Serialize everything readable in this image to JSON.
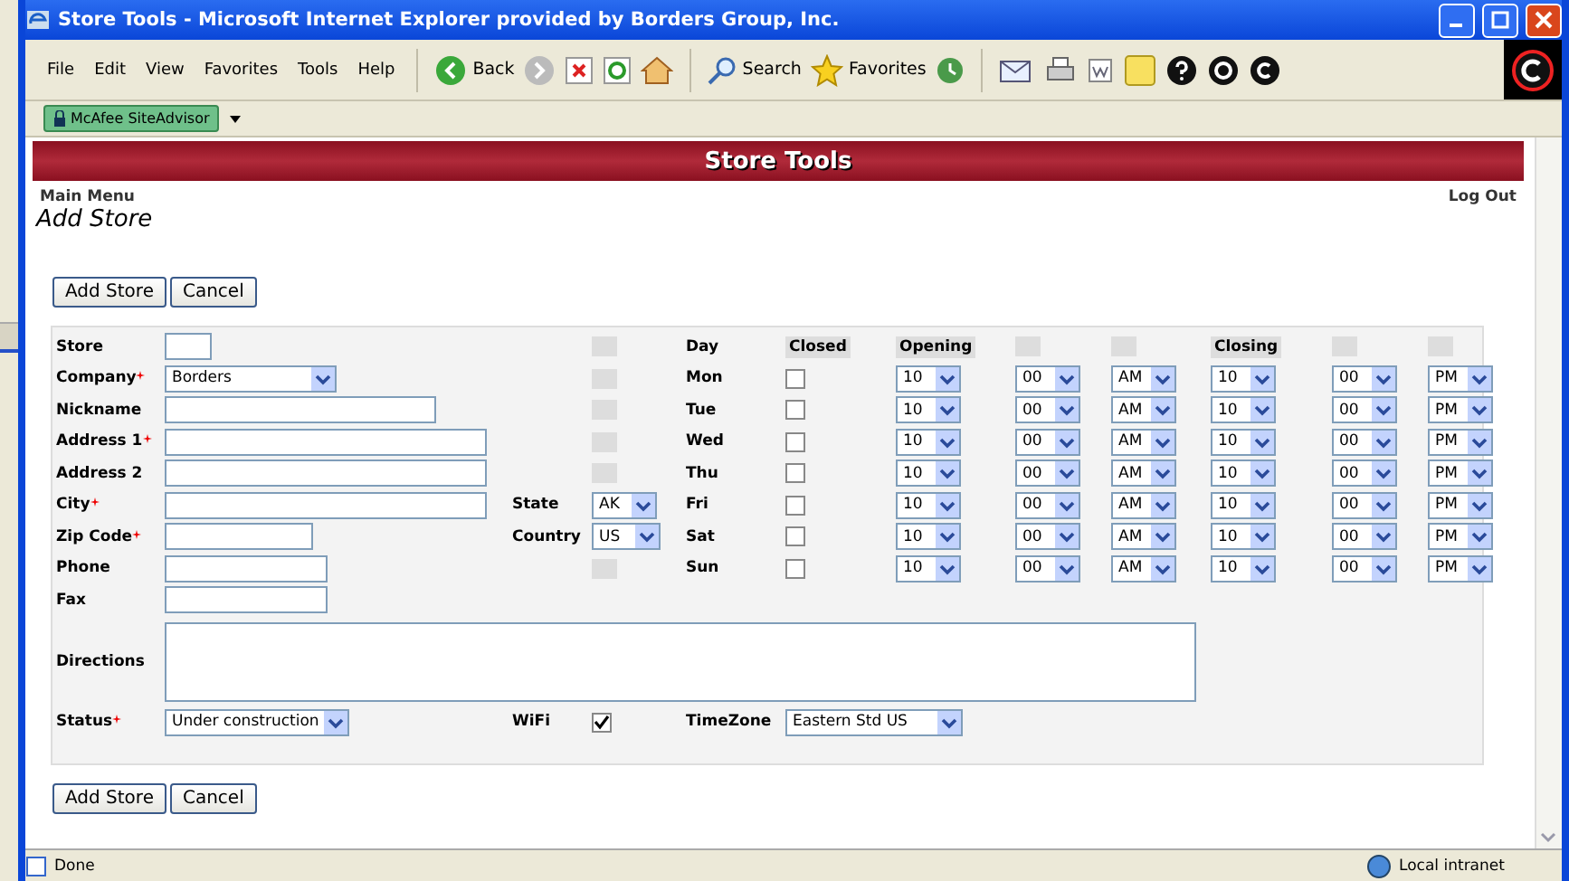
{
  "window": {
    "title": "Store Tools - Microsoft Internet Explorer provided by Borders Group, Inc."
  },
  "menu": [
    "File",
    "Edit",
    "View",
    "Favorites",
    "Tools",
    "Help"
  ],
  "toolbar": {
    "back": "Back",
    "search": "Search",
    "favorites": "Favorites"
  },
  "addon_bar": {
    "button": "McAfee SiteAdvisor"
  },
  "banner": {
    "title": "Store Tools"
  },
  "nav": {
    "main_menu": "Main Menu",
    "log_out": "Log Out"
  },
  "heading": "Add Store",
  "buttons": [
    "Add Store",
    "Cancel"
  ],
  "bottom_buttons": [
    "Add Store",
    "Cancel"
  ],
  "fields": [
    {
      "label": "Store",
      "kind": "text",
      "required": false
    },
    {
      "label": "Company",
      "kind": "select",
      "required": true,
      "value": "Borders"
    },
    {
      "label": "Nickname",
      "kind": "text",
      "required": false
    },
    {
      "label": "Address 1",
      "kind": "text",
      "required": true
    },
    {
      "label": "Address 2",
      "kind": "text",
      "required": false
    },
    {
      "label": "City",
      "kind": "text",
      "required": true
    },
    {
      "label": "Zip Code",
      "kind": "text",
      "required": true
    },
    {
      "label": "Phone",
      "kind": "text",
      "required": false
    },
    {
      "label": "Fax",
      "kind": "text",
      "required": false
    }
  ],
  "location": [
    {
      "label": "State",
      "value": "AK"
    },
    {
      "label": "Country",
      "value": "US"
    }
  ],
  "schedule_headers": {
    "day": "Day",
    "closed": "Closed",
    "opening": "Opening",
    "closing": "Closing"
  },
  "days": [
    {
      "day": "Mon",
      "closed": false,
      "open_hour": "10",
      "open_minute": "00",
      "open_ampm": "AM",
      "close_hour": "10",
      "close_minute": "00",
      "close_ampm": "PM"
    },
    {
      "day": "Tue",
      "closed": false,
      "open_hour": "10",
      "open_minute": "00",
      "open_ampm": "AM",
      "close_hour": "10",
      "close_minute": "00",
      "close_ampm": "PM"
    },
    {
      "day": "Wed",
      "closed": false,
      "open_hour": "10",
      "open_minute": "00",
      "open_ampm": "AM",
      "close_hour": "10",
      "close_minute": "00",
      "close_ampm": "PM"
    },
    {
      "day": "Thu",
      "closed": false,
      "open_hour": "10",
      "open_minute": "00",
      "open_ampm": "AM",
      "close_hour": "10",
      "close_minute": "00",
      "close_ampm": "PM"
    },
    {
      "day": "Fri",
      "closed": false,
      "open_hour": "10",
      "open_minute": "00",
      "open_ampm": "AM",
      "close_hour": "10",
      "close_minute": "00",
      "close_ampm": "PM"
    },
    {
      "day": "Sat",
      "closed": false,
      "open_hour": "10",
      "open_minute": "00",
      "open_ampm": "AM",
      "close_hour": "10",
      "close_minute": "00",
      "close_ampm": "PM"
    },
    {
      "day": "Sun",
      "closed": false,
      "open_hour": "10",
      "open_minute": "00",
      "open_ampm": "AM",
      "close_hour": "10",
      "close_minute": "00",
      "close_ampm": "PM"
    }
  ],
  "directions": {
    "label": "Directions"
  },
  "status": {
    "label": "Status",
    "required": true,
    "value": "Under construction"
  },
  "wifi": {
    "label": "WiFi",
    "checked": true
  },
  "timezone": {
    "label": "TimeZone",
    "value": "Eastern Std US"
  },
  "status_bar": {
    "text": "Done",
    "zone": "Local intranet"
  }
}
